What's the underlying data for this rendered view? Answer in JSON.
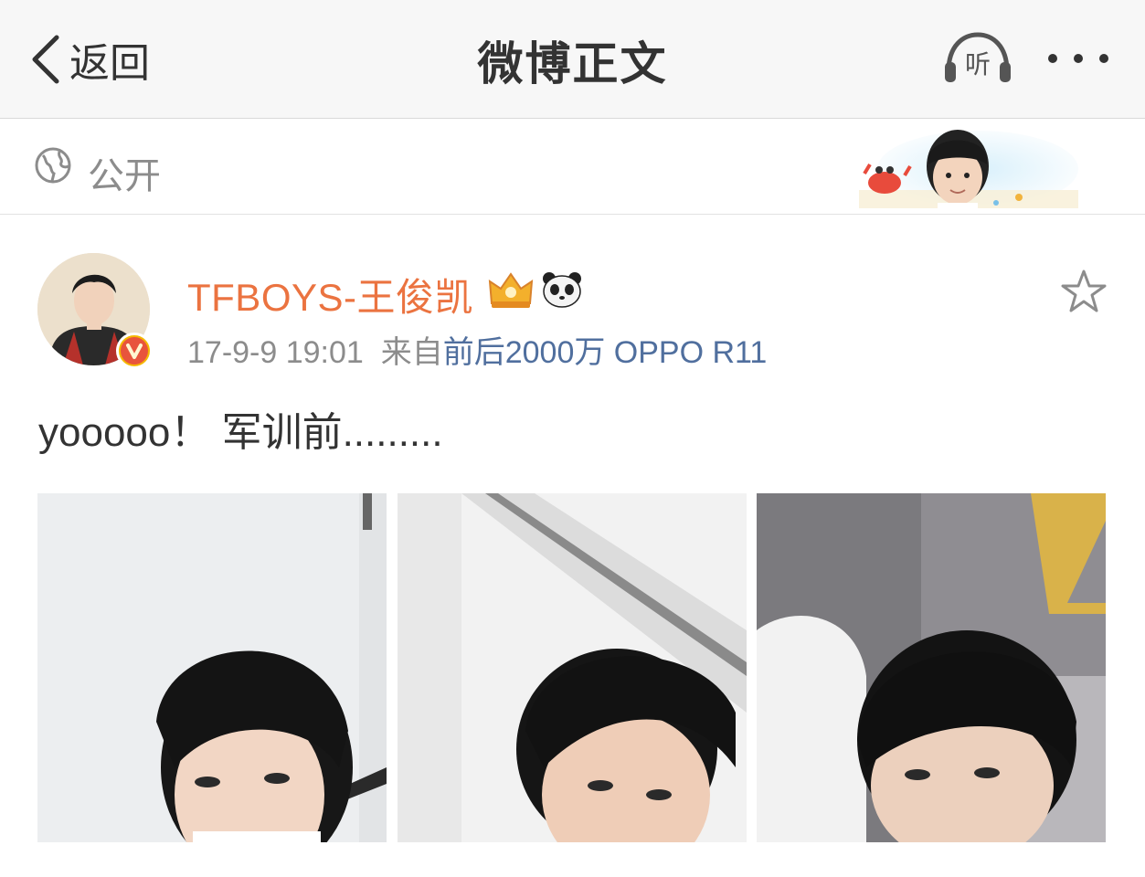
{
  "nav": {
    "back_label": "返回",
    "title": "微博正文",
    "listen_label": "听"
  },
  "visibility": {
    "label": "公开"
  },
  "post": {
    "username": "TFBOYS-王俊凯",
    "time": "17-9-9 19:01",
    "from_label": "来自",
    "source": "前后2000万 OPPO R11",
    "text": "yooooo！ 军训前........."
  },
  "colors": {
    "username": "#eb7340",
    "source_link": "#506f9e",
    "meta_gray": "#8c8c8c",
    "navbar_bg": "#f7f7f7"
  },
  "icons": [
    "back-chevron-icon",
    "headphones-icon",
    "more-dots-icon",
    "globe-icon",
    "crown-icon",
    "panda-icon",
    "star-icon",
    "verified-v-icon"
  ]
}
